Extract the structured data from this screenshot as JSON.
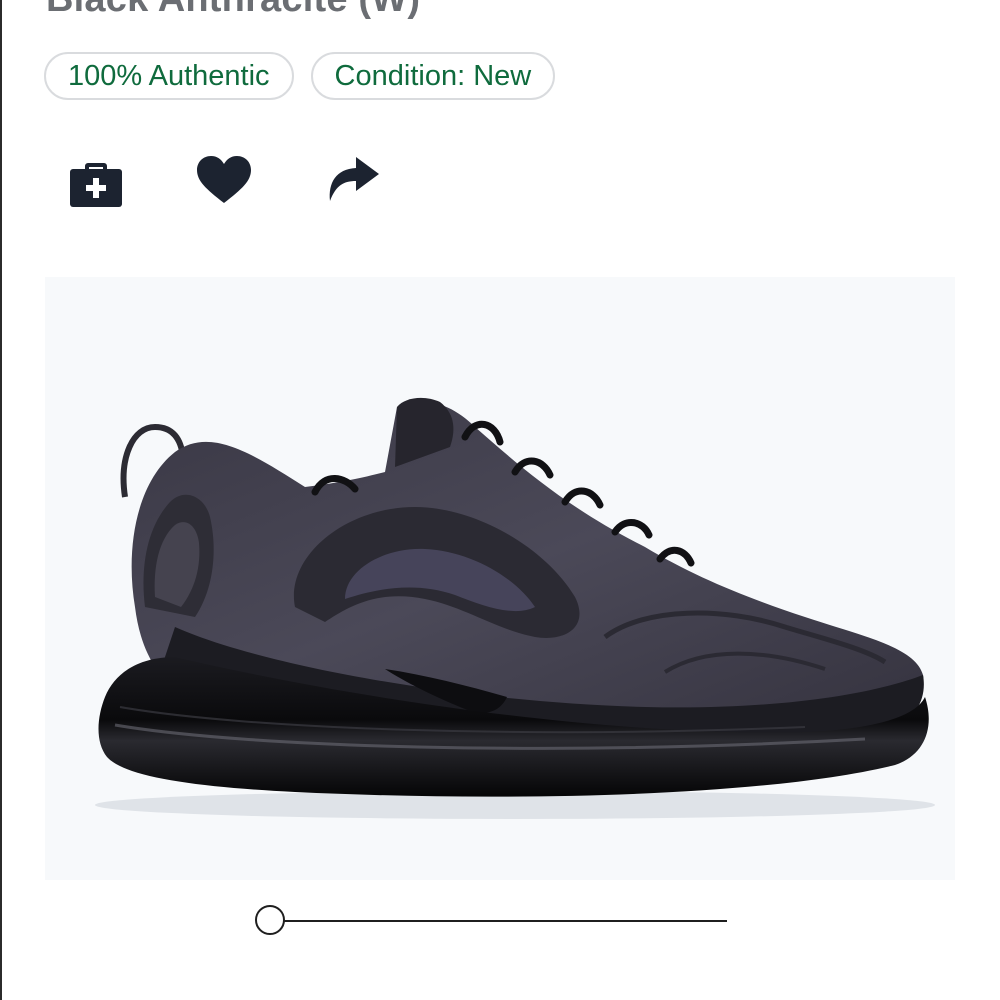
{
  "product": {
    "title": "Black Anthracite (W)"
  },
  "badges": [
    {
      "label": "100% Authentic"
    },
    {
      "label": "Condition: New"
    }
  ],
  "actions": {
    "portfolio_icon": "briefcase-plus-icon",
    "favorite_icon": "heart-icon",
    "share_icon": "share-arrow-icon"
  },
  "image_viewer": {
    "product_image": "sneaker-side-view",
    "rotation_slider_position": 0.0
  },
  "colors": {
    "badge_text": "#0f6b3d",
    "badge_border": "#d9dbde",
    "icon": "#1c2330",
    "title": "#6b6e73",
    "image_background": "#f7f9fb"
  }
}
